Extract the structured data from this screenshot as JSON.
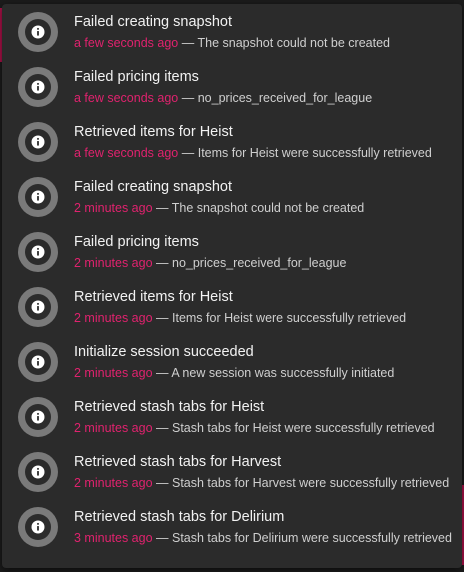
{
  "colors": {
    "accent": "#e0226e",
    "panel": "#2b2b2b",
    "icon_ring": "#7a7a7a"
  },
  "notifications": [
    {
      "icon": "info-icon",
      "title": "Failed creating snapshot",
      "time": "a few seconds ago",
      "message": "The snapshot could not be created"
    },
    {
      "icon": "info-icon",
      "title": "Failed pricing items",
      "time": "a few seconds ago",
      "message": "no_prices_received_for_league"
    },
    {
      "icon": "info-icon",
      "title": "Retrieved items for Heist",
      "time": "a few seconds ago",
      "message": "Items for Heist were successfully retrieved"
    },
    {
      "icon": "info-icon",
      "title": "Failed creating snapshot",
      "time": "2 minutes ago",
      "message": "The snapshot could not be created"
    },
    {
      "icon": "info-icon",
      "title": "Failed pricing items",
      "time": "2 minutes ago",
      "message": "no_prices_received_for_league"
    },
    {
      "icon": "info-icon",
      "title": "Retrieved items for Heist",
      "time": "2 minutes ago",
      "message": "Items for Heist were successfully retrieved"
    },
    {
      "icon": "info-icon",
      "title": "Initialize session succeeded",
      "time": "2 minutes ago",
      "message": "A new session was successfully initiated"
    },
    {
      "icon": "info-icon",
      "title": "Retrieved stash tabs for Heist",
      "time": "2 minutes ago",
      "message": "Stash tabs for Heist were successfully retrieved"
    },
    {
      "icon": "info-icon",
      "title": "Retrieved stash tabs for Harvest",
      "time": "2 minutes ago",
      "message": "Stash tabs for Harvest were successfully retrieved"
    },
    {
      "icon": "info-icon",
      "title": "Retrieved stash tabs for Delirium",
      "time": "3 minutes ago",
      "message": "Stash tabs for Delirium were successfully retrieved"
    }
  ],
  "separator": "—"
}
